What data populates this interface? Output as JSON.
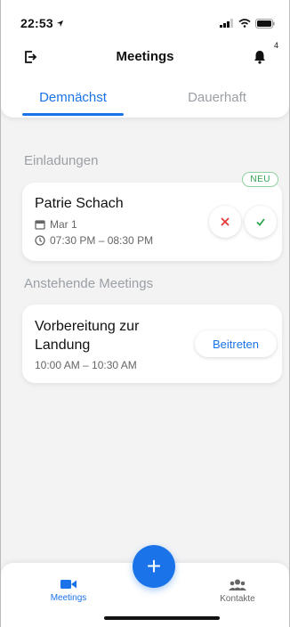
{
  "status": {
    "time": "22:53"
  },
  "header": {
    "title": "Meetings",
    "notification_count": "4"
  },
  "tabs": [
    {
      "label": "Demnächst",
      "active": true
    },
    {
      "label": "Dauerhaft",
      "active": false
    }
  ],
  "invites": {
    "section_title": "Einladungen",
    "badge": "NEU",
    "item": {
      "title": "Patrie Schach",
      "date": "Mar 1",
      "time": "07:30 PM – 08:30 PM"
    }
  },
  "upcoming": {
    "section_title": "Anstehende Meetings",
    "item": {
      "title": "Vorbereitung zur Landung",
      "time": "10:00 AM – 10:30 AM",
      "join_label": "Beitreten"
    }
  },
  "bottom_nav": {
    "meetings": "Meetings",
    "contacts": "Kontakte",
    "fab": "+"
  },
  "colors": {
    "accent": "#1a73e8",
    "reject": "#e53935",
    "accept": "#2ea44f"
  }
}
